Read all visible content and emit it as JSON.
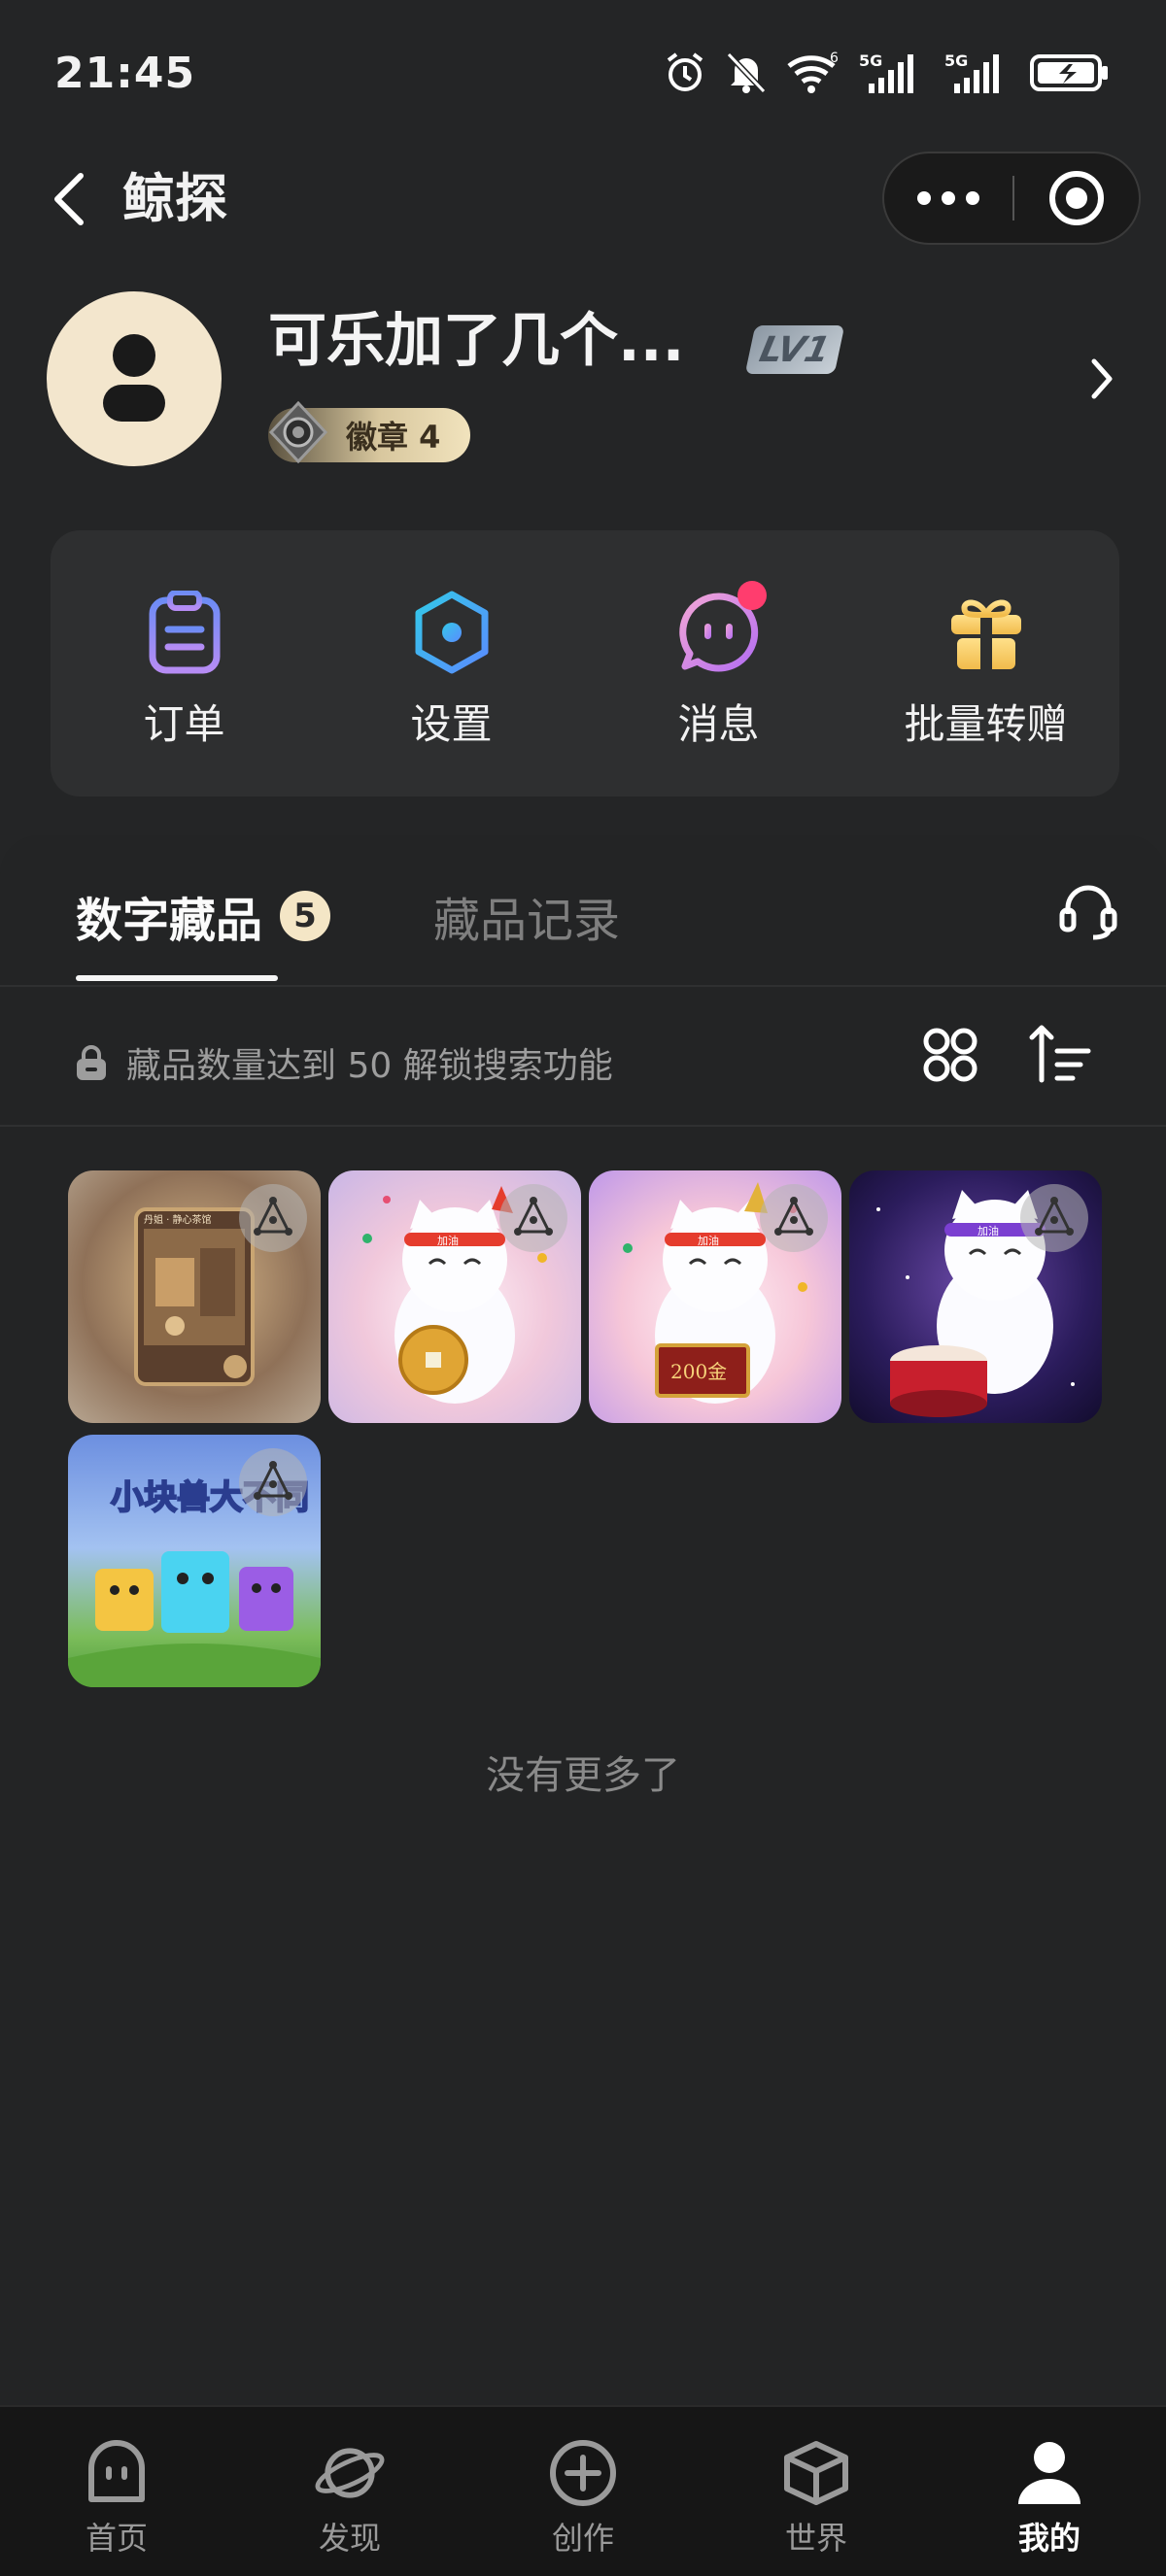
{
  "status_bar": {
    "time": "21:45",
    "signal1_label": "5G",
    "signal2_label": "5G",
    "wifi_label": "6"
  },
  "header": {
    "title": "鲸探"
  },
  "profile": {
    "name": "可乐加了几个...",
    "level": "LV1",
    "medal_label": "徽章 4"
  },
  "actions": [
    {
      "label": "订单",
      "icon": "clipboard-icon",
      "color": "#8f8cf4"
    },
    {
      "label": "设置",
      "icon": "hexagon-icon",
      "color": "#46b6ff"
    },
    {
      "label": "消息",
      "icon": "chat-face-icon",
      "color": "#d98bf0",
      "has_notification": true
    },
    {
      "label": "批量转赠",
      "icon": "gift-icon",
      "color": "#f6d27a"
    }
  ],
  "tabs": {
    "active": "数字藏品",
    "active_count": "5",
    "inactive": "藏品记录"
  },
  "toolbar": {
    "lock_text": "藏品数量达到 50 解锁搜索功能"
  },
  "collection_items": [
    {
      "name": "card-1"
    },
    {
      "name": "card-2"
    },
    {
      "name": "card-3"
    },
    {
      "name": "card-4"
    },
    {
      "name": "card-5"
    }
  ],
  "card_texts": {
    "card1_caption": "丹姐 · 静心茶馆",
    "card3_plaque": "200金",
    "card2_band": "加油",
    "card3_band": "加油",
    "card4_band": "加油",
    "card5_title": "小块兽大不同"
  },
  "footer_text": "没有更多了",
  "bottom_nav": [
    {
      "label": "首页",
      "icon": "home-face-icon",
      "active": false
    },
    {
      "label": "发现",
      "icon": "planet-icon",
      "active": false
    },
    {
      "label": "创作",
      "icon": "plus-circle-icon",
      "active": false
    },
    {
      "label": "世界",
      "icon": "cube-icon",
      "active": false
    },
    {
      "label": "我的",
      "icon": "person-icon",
      "active": true
    }
  ]
}
